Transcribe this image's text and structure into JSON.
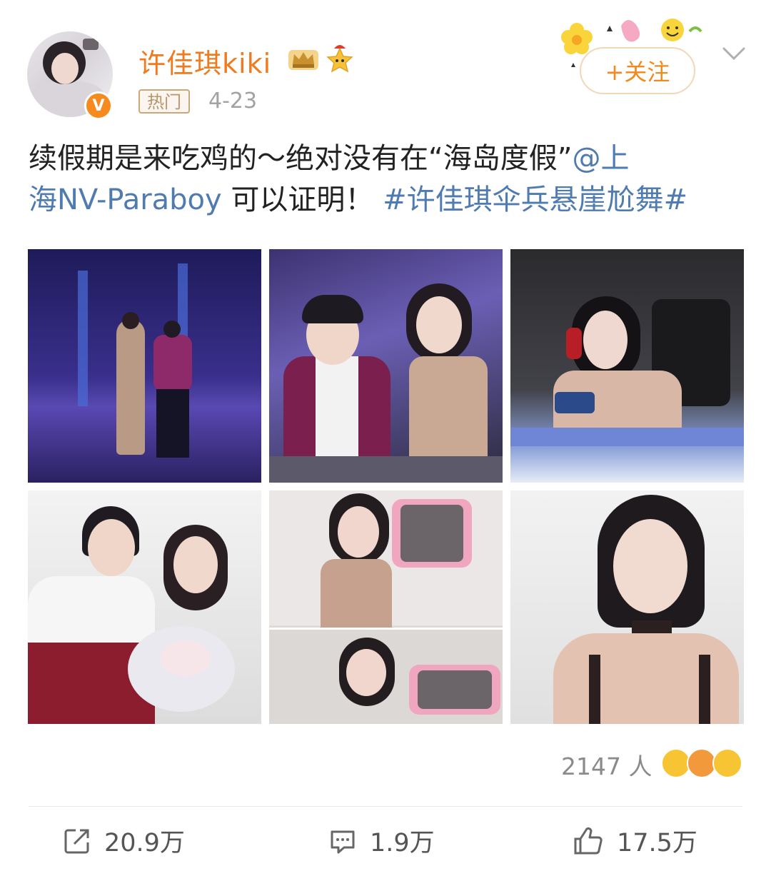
{
  "header": {
    "username": "许佳琪kiki",
    "hot_tag": "热门",
    "date": "4-23",
    "follow_label": "+关注",
    "verified_mark": "V"
  },
  "post": {
    "text_plain": "续假期是来吃鸡的～绝对没有在“海岛度假”",
    "mention_line1": "@上",
    "mention_line2": "海NV-Paraboy",
    "text_after": " 可以证明！",
    "hashtag": "#许佳琪伞兵悬崖尬舞#"
  },
  "images": [
    {
      "id": "photo-1"
    },
    {
      "id": "photo-2"
    },
    {
      "id": "photo-3"
    },
    {
      "id": "photo-4"
    },
    {
      "id": "photo-5"
    },
    {
      "id": "photo-6"
    }
  ],
  "reactions": {
    "count_label": "2147 人",
    "emojis": [
      "laughing-emoji",
      "kiss-emoji",
      "surprised-emoji"
    ]
  },
  "actions": {
    "repost": "20.9万",
    "comment": "1.9万",
    "like": "17.5万"
  },
  "colors": {
    "username": "#f07a1e",
    "link": "#4f7bb1",
    "follow_text": "#f08a1c",
    "verified_badge": "#f78a1d"
  }
}
